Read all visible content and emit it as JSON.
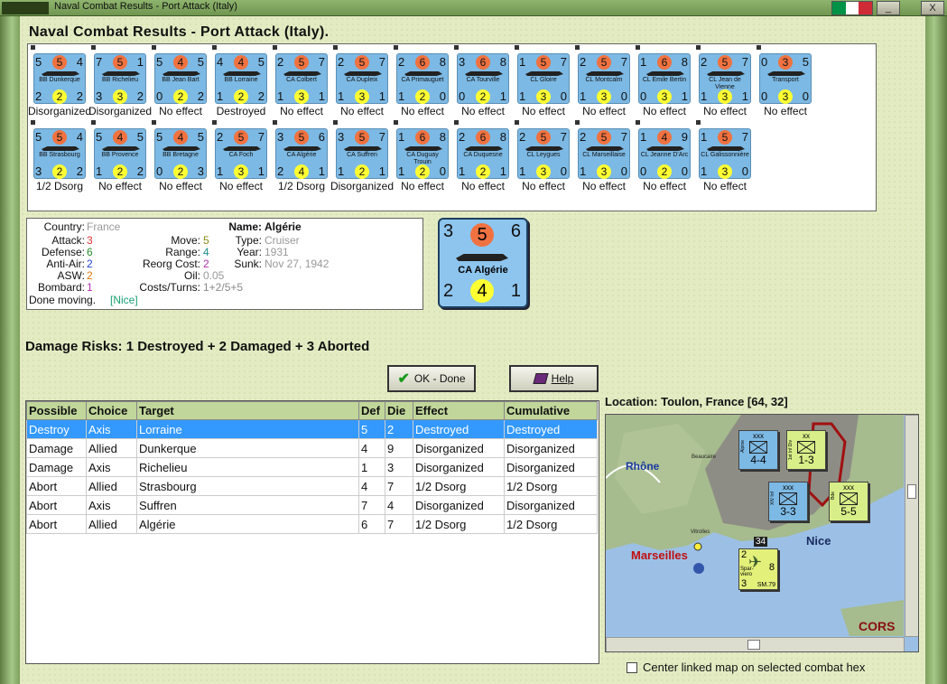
{
  "window": {
    "title": "Naval Combat Results - Port Attack (Italy)",
    "minimize_label": "_",
    "close_label": "X"
  },
  "flag_colors": [
    "#009246",
    "#ffffff",
    "#ce2b37"
  ],
  "header": {
    "title": "Naval Combat Results - Port Attack (Italy)."
  },
  "roster": [
    {
      "tl": "5",
      "atk": "5",
      "tr": "4",
      "name": "BB Dunkerque",
      "bl": "2",
      "def": "2",
      "br": "2",
      "result": "Disorganized"
    },
    {
      "tl": "7",
      "atk": "5",
      "tr": "1",
      "name": "BB Richelieu",
      "bl": "3",
      "def": "3",
      "br": "2",
      "result": "Disorganized"
    },
    {
      "tl": "5",
      "atk": "4",
      "tr": "5",
      "name": "BB Jean Bart",
      "bl": "0",
      "def": "2",
      "br": "2",
      "result": "No effect"
    },
    {
      "tl": "4",
      "atk": "4",
      "tr": "5",
      "name": "BB Lorraine",
      "bl": "1",
      "def": "2",
      "br": "2",
      "result": "Destroyed"
    },
    {
      "tl": "2",
      "atk": "5",
      "tr": "7",
      "name": "CA Colbert",
      "bl": "1",
      "def": "3",
      "br": "1",
      "result": "No effect"
    },
    {
      "tl": "2",
      "atk": "5",
      "tr": "7",
      "name": "CA Dupleix",
      "bl": "1",
      "def": "3",
      "br": "1",
      "result": "No effect"
    },
    {
      "tl": "2",
      "atk": "6",
      "tr": "8",
      "name": "CA Primauguet",
      "bl": "1",
      "def": "2",
      "br": "0",
      "result": "No effect"
    },
    {
      "tl": "3",
      "atk": "6",
      "tr": "8",
      "name": "CA Tourville",
      "bl": "0",
      "def": "2",
      "br": "1",
      "result": "No effect"
    },
    {
      "tl": "1",
      "atk": "5",
      "tr": "7",
      "name": "CL Gloire",
      "bl": "1",
      "def": "3",
      "br": "0",
      "result": "No effect"
    },
    {
      "tl": "2",
      "atk": "5",
      "tr": "7",
      "name": "CL Montcalm",
      "bl": "1",
      "def": "3",
      "br": "0",
      "result": "No effect"
    },
    {
      "tl": "1",
      "atk": "6",
      "tr": "8",
      "name": "CL Emile Bertin",
      "bl": "0",
      "def": "3",
      "br": "1",
      "result": "No effect"
    },
    {
      "tl": "2",
      "atk": "5",
      "tr": "7",
      "name": "CL Jean de Vienne",
      "bl": "1",
      "def": "3",
      "br": "1",
      "result": "No effect"
    },
    {
      "tl": "0",
      "atk": "3",
      "tr": "5",
      "name": "Transport",
      "bl": "0",
      "def": "3",
      "br": "0",
      "result": "No effect"
    },
    {
      "tl": "5",
      "atk": "5",
      "tr": "4",
      "name": "BB Strasbourg",
      "bl": "3",
      "def": "2",
      "br": "2",
      "result": "1/2 Dsorg"
    },
    {
      "tl": "5",
      "atk": "4",
      "tr": "5",
      "name": "BB Provence",
      "bl": "1",
      "def": "2",
      "br": "2",
      "result": "No effect"
    },
    {
      "tl": "5",
      "atk": "4",
      "tr": "5",
      "name": "BB Bretagne",
      "bl": "0",
      "def": "2",
      "br": "3",
      "result": "No effect"
    },
    {
      "tl": "2",
      "atk": "5",
      "tr": "7",
      "name": "CA Foch",
      "bl": "1",
      "def": "3",
      "br": "1",
      "result": "No effect"
    },
    {
      "tl": "3",
      "atk": "5",
      "tr": "6",
      "name": "CA Algérie",
      "bl": "2",
      "def": "4",
      "br": "1",
      "result": "1/2 Dsorg"
    },
    {
      "tl": "3",
      "atk": "5",
      "tr": "7",
      "name": "CA Suffren",
      "bl": "1",
      "def": "2",
      "br": "1",
      "result": "Disorganized"
    },
    {
      "tl": "1",
      "atk": "6",
      "tr": "8",
      "name": "CA Duguay Trouin",
      "bl": "1",
      "def": "2",
      "br": "0",
      "result": "No effect"
    },
    {
      "tl": "2",
      "atk": "6",
      "tr": "8",
      "name": "CA Duquesne",
      "bl": "1",
      "def": "2",
      "br": "1",
      "result": "No effect"
    },
    {
      "tl": "2",
      "atk": "5",
      "tr": "7",
      "name": "CL Leygues",
      "bl": "1",
      "def": "3",
      "br": "0",
      "result": "No effect"
    },
    {
      "tl": "2",
      "atk": "5",
      "tr": "7",
      "name": "CL Marseillaise",
      "bl": "1",
      "def": "3",
      "br": "0",
      "result": "No effect"
    },
    {
      "tl": "1",
      "atk": "4",
      "tr": "9",
      "name": "CL Jeanne D'Arc",
      "bl": "0",
      "def": "2",
      "br": "0",
      "result": "No effect"
    },
    {
      "tl": "1",
      "atk": "5",
      "tr": "7",
      "name": "CL Galissonnière",
      "bl": "1",
      "def": "3",
      "br": "0",
      "result": "No effect"
    }
  ],
  "info": {
    "country_label": "Country:",
    "country": "France",
    "attack_label": "Attack:",
    "attack": "3",
    "defense_label": "Defense:",
    "defense": "6",
    "antiair_label": "Anti-Air:",
    "antiair": "2",
    "asw_label": "ASW:",
    "asw": "2",
    "bombard_label": "Bombard:",
    "bombard": "1",
    "move_label": "Move:",
    "move": "5",
    "range_label": "Range:",
    "range": "4",
    "reorg_label": "Reorg Cost:",
    "reorg": "2",
    "oil_label": "Oil:",
    "oil": "0.05",
    "costs_label": "Costs/Turns:",
    "costs": "1+2/5+5",
    "name_label": "Name:",
    "name": "Algérie",
    "type_label": "Type:",
    "type": "Cruiser",
    "year_label": "Year:",
    "year": "1931",
    "sunk_label": "Sunk:",
    "sunk": "Nov 27, 1942",
    "done": "Done moving.",
    "nice": "[Nice]"
  },
  "big_counter": {
    "tl": "3",
    "atk": "5",
    "tr": "6",
    "name": "CA Algérie",
    "bl": "2",
    "def": "4",
    "br": "1"
  },
  "risks": "Damage Risks:  1 Destroyed + 2 Damaged + 3 Aborted",
  "buttons": {
    "ok": "OK - Done",
    "help": "Help"
  },
  "table": {
    "headers": [
      "Possible",
      "Choice",
      "Target",
      "Def",
      "Die",
      "Effect",
      "Cumulative"
    ],
    "rows": [
      [
        "Destroy",
        "Axis",
        "Lorraine",
        "5",
        "2",
        "Destroyed",
        "Destroyed"
      ],
      [
        "Damage",
        "Allied",
        "Dunkerque",
        "4",
        "9",
        "Disorganized",
        "Disorganized"
      ],
      [
        "Damage",
        "Axis",
        "Richelieu",
        "1",
        "3",
        "Disorganized",
        "Disorganized"
      ],
      [
        "Abort",
        "Allied",
        "Strasbourg",
        "4",
        "7",
        "1/2 Dsorg",
        "1/2 Dsorg"
      ],
      [
        "Abort",
        "Axis",
        "Suffren",
        "7",
        "4",
        "Disorganized",
        "Disorganized"
      ],
      [
        "Abort",
        "Allied",
        "Algérie",
        "6",
        "7",
        "1/2 Dsorg",
        "1/2 Dsorg"
      ]
    ]
  },
  "location": "Location:  Toulon, France [64, 32]",
  "map": {
    "labels": {
      "rhone": "Rhône",
      "marseilles": "Marseilles",
      "nice": "Nice",
      "corsica": "CORS",
      "beaucaire": "Beaucaire",
      "vitrolles": "Vitrolles",
      "hex34": "34"
    },
    "units": [
      {
        "size": "xxx",
        "name": "Alpine",
        "value": "4-4"
      },
      {
        "size": "xx",
        "name": "1st Inf Div",
        "value": "1-3"
      },
      {
        "size": "xxx",
        "name": "XIV Inf",
        "value": "3-3"
      },
      {
        "size": "xxx",
        "name": "Bde",
        "value": "5-5"
      }
    ],
    "air": {
      "tl": "2",
      "tr": "8",
      "bl": "3",
      "name": "Spar-viero",
      "br": "SM.79"
    }
  },
  "center_checkbox": "Center linked map on selected combat hex"
}
